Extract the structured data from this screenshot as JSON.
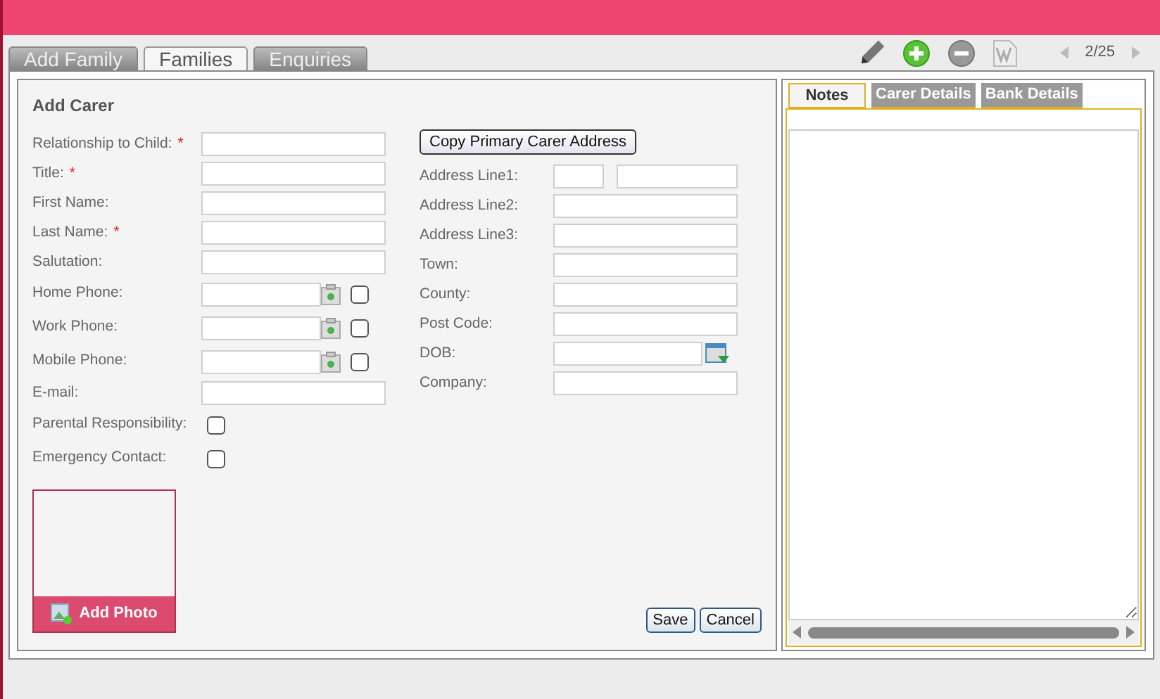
{
  "tabs": [
    {
      "label": "Add Family",
      "selected": false
    },
    {
      "label": "Families",
      "selected": true
    },
    {
      "label": "Enquiries",
      "selected": false
    }
  ],
  "toolbar": {
    "pager": "2/25"
  },
  "form": {
    "title": "Add Carer",
    "left_fields": [
      {
        "label": "Relationship to Child:",
        "required_mark": "*",
        "kind": "text"
      },
      {
        "label": "Title:",
        "required_mark": "*",
        "kind": "text"
      },
      {
        "label": "First Name:",
        "kind": "text"
      },
      {
        "label": "Last Name:",
        "required_mark": "*",
        "kind": "text"
      },
      {
        "label": "Salutation:",
        "kind": "text"
      },
      {
        "label": "Home Phone:",
        "kind": "phone",
        "checked": false
      },
      {
        "label": "Work Phone:",
        "kind": "phone",
        "checked": false
      },
      {
        "label": "Mobile Phone:",
        "kind": "phone",
        "checked": false
      },
      {
        "label": "E-mail:",
        "kind": "text"
      },
      {
        "label": "Parental Responsibility:",
        "kind": "checkbox",
        "checked": false
      },
      {
        "label": "Emergency Contact:",
        "kind": "checkbox",
        "checked": false
      }
    ],
    "copy_button": "Copy Primary Carer Address",
    "right_fields": [
      {
        "label": "Address Line1:",
        "kind": "split"
      },
      {
        "label": "Address Line2:",
        "kind": "text"
      },
      {
        "label": "Address Line3:",
        "kind": "text"
      },
      {
        "label": "Town:",
        "kind": "text"
      },
      {
        "label": "County:",
        "kind": "text"
      },
      {
        "label": "Post Code:",
        "kind": "text"
      },
      {
        "label": "DOB:",
        "kind": "date"
      },
      {
        "label": "Company:",
        "kind": "text"
      }
    ],
    "add_photo": "Add Photo",
    "buttons": [
      "Save",
      "Cancel"
    ]
  },
  "side_tabs": [
    {
      "label": "Notes",
      "selected": true
    },
    {
      "label": "Carer Details",
      "selected": false
    },
    {
      "label": "Bank Details",
      "selected": false
    }
  ]
}
